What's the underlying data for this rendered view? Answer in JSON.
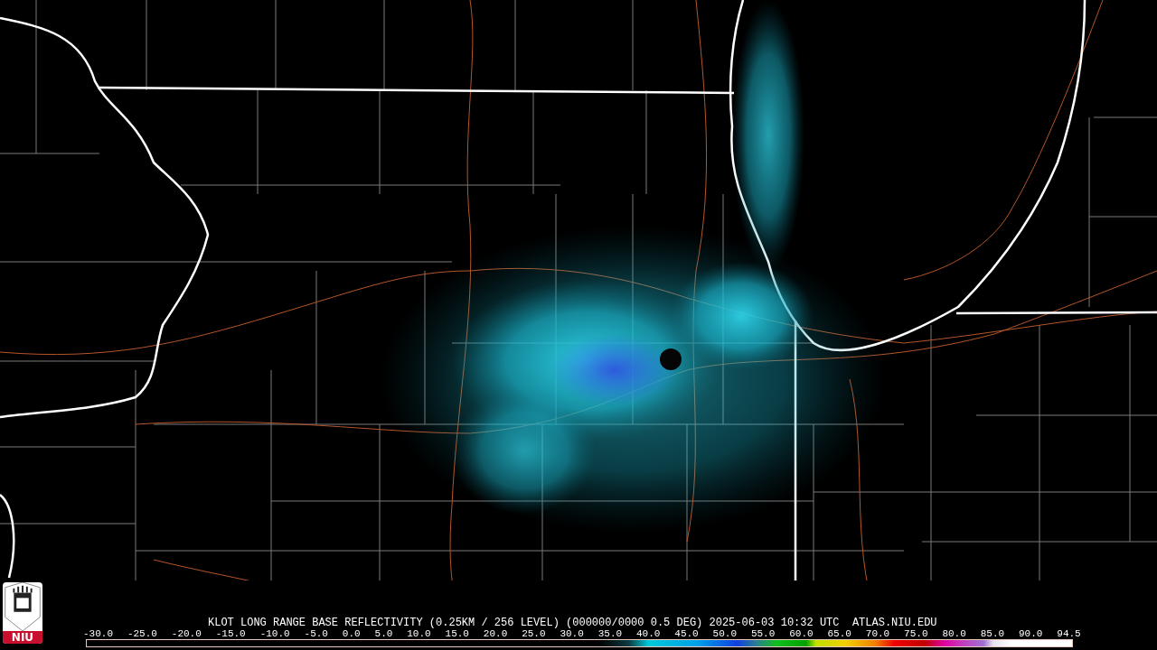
{
  "logo": {
    "text": "NIU"
  },
  "caption": "KLOT LONG RANGE BASE REFLECTIVITY (0.25KM / 256 LEVEL) (000000/0000 0.5 DEG) 2025-06-03 10:32 UTC  ATLAS.NIU.EDU",
  "scale_labels": [
    "-30.0",
    "-25.0",
    "-20.0",
    "-15.0",
    "-10.0",
    "-5.0",
    "0.0",
    "5.0",
    "10.0",
    "15.0",
    "20.0",
    "25.0",
    "30.0",
    "35.0",
    "40.0",
    "45.0",
    "50.0",
    "55.0",
    "60.0",
    "65.0",
    "70.0",
    "75.0",
    "80.0",
    "85.0",
    "90.0",
    "94.5"
  ]
}
